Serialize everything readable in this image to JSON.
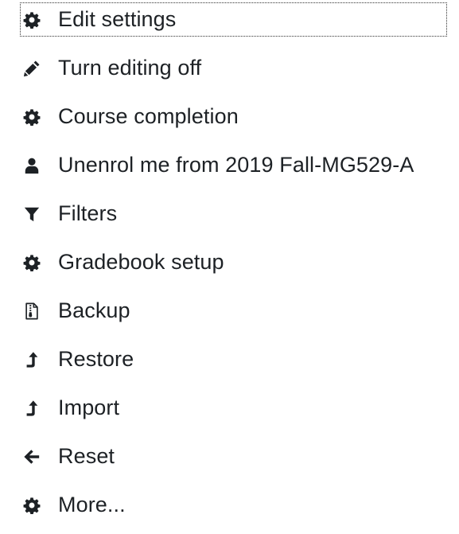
{
  "colors": {
    "text": "#1d2125",
    "icon": "#1d2125",
    "focus_outline": "#333333",
    "background": "#ffffff"
  },
  "menu": {
    "items": [
      {
        "label": "Edit settings",
        "icon": "gear-icon",
        "focused": true
      },
      {
        "label": "Turn editing off",
        "icon": "pencil-icon",
        "focused": false
      },
      {
        "label": "Course completion",
        "icon": "gear-icon",
        "focused": false
      },
      {
        "label": "Unenrol me from 2019 Fall-MG529-A",
        "icon": "user-icon",
        "focused": false
      },
      {
        "label": "Filters",
        "icon": "filter-icon",
        "focused": false
      },
      {
        "label": "Gradebook setup",
        "icon": "gear-icon",
        "focused": false
      },
      {
        "label": "Backup",
        "icon": "file-archive-icon",
        "focused": false
      },
      {
        "label": "Restore",
        "icon": "level-up-icon",
        "focused": false
      },
      {
        "label": "Import",
        "icon": "level-up-icon",
        "focused": false
      },
      {
        "label": "Reset",
        "icon": "arrow-left-icon",
        "focused": false
      },
      {
        "label": "More...",
        "icon": "gear-icon",
        "focused": false
      }
    ]
  }
}
